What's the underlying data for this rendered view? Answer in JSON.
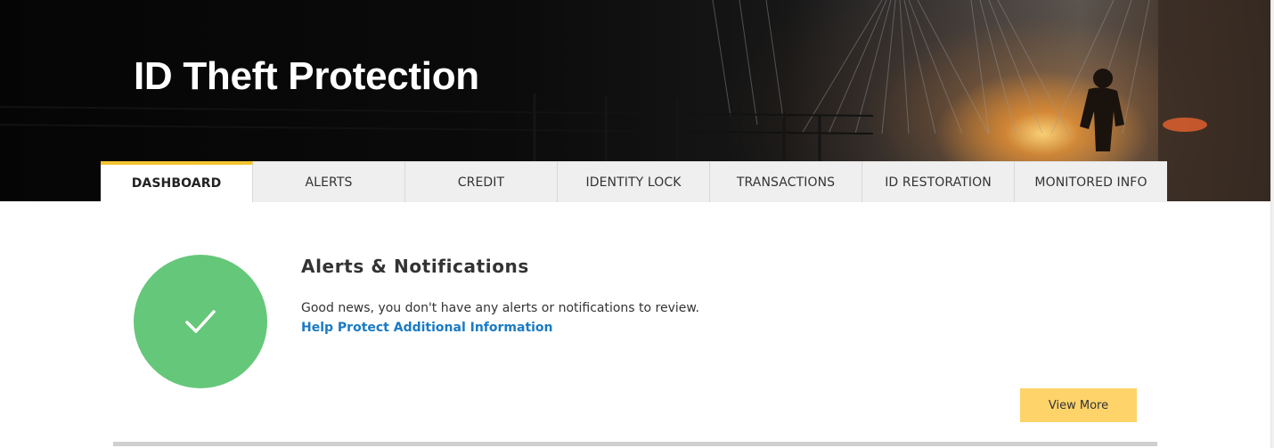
{
  "hero": {
    "title": "ID Theft Protection"
  },
  "tabs": [
    {
      "label": "DASHBOARD",
      "active": true
    },
    {
      "label": "ALERTS",
      "active": false
    },
    {
      "label": "CREDIT",
      "active": false
    },
    {
      "label": "IDENTITY LOCK",
      "active": false
    },
    {
      "label": "TRANSACTIONS",
      "active": false
    },
    {
      "label": "ID RESTORATION",
      "active": false
    },
    {
      "label": "MONITORED INFO",
      "active": false
    }
  ],
  "alerts": {
    "title": "Alerts & Notifications",
    "message": "Good news, you don't have any alerts or notifications to review.",
    "link_label": "Help Protect Additional Information",
    "view_more_label": "View More",
    "status_icon": "checkmark-icon"
  },
  "colors": {
    "accent_tab": "#f4c430",
    "status_ok": "#65c779",
    "link": "#1a7ac4",
    "button": "#fdd36a"
  }
}
